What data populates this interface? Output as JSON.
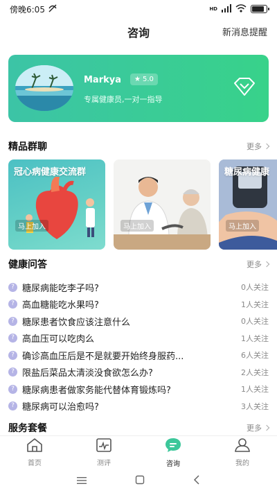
{
  "status_bar": {
    "time": "傍晚6:05",
    "network": "HD",
    "battery_level": 0.75
  },
  "header": {
    "title": "咨询",
    "right_action": "新消息提醒"
  },
  "member_card": {
    "name": "Markya",
    "rating": "5.0",
    "description": "专属健康员,一对一指导",
    "icon": "diamond-icon"
  },
  "groups_section": {
    "title": "精品群聊",
    "more": "更多",
    "cards": [
      {
        "title": "冠心病健康交流群",
        "join": "马上加入"
      },
      {
        "title": "",
        "join": "马上加入"
      },
      {
        "title": "糖尿病健康",
        "join": "马上加入"
      }
    ]
  },
  "qa_section": {
    "title": "健康问答",
    "more": "更多",
    "items": [
      {
        "question": "糖尿病能吃李子吗?",
        "followers": "0人关注"
      },
      {
        "question": "高血糖能吃水果吗?",
        "followers": "1人关注"
      },
      {
        "question": "糖尿患者饮食应该注意什么",
        "followers": "0人关注"
      },
      {
        "question": "高血压可以吃肉么",
        "followers": "1人关注"
      },
      {
        "question": "确诊高血压后是不是就要开始终身服药...",
        "followers": "6人关注"
      },
      {
        "question": "限盐后菜品太清淡没食欲怎么办?",
        "followers": "2人关注"
      },
      {
        "question": "糖尿病患者做家务能代替体育锻炼吗?",
        "followers": "1人关注"
      },
      {
        "question": "糖尿病可以治愈吗?",
        "followers": "3人关注"
      }
    ]
  },
  "service_section": {
    "title": "服务套餐",
    "more": "更多"
  },
  "tabbar": {
    "tabs": [
      {
        "label": "首页",
        "icon": "home-icon"
      },
      {
        "label": "测评",
        "icon": "assessment-icon"
      },
      {
        "label": "咨询",
        "icon": "chat-icon",
        "active": true
      },
      {
        "label": "我的",
        "icon": "profile-icon"
      }
    ]
  },
  "colors": {
    "accent": "#3cc79a",
    "qa_icon": "#b5b4e6"
  }
}
